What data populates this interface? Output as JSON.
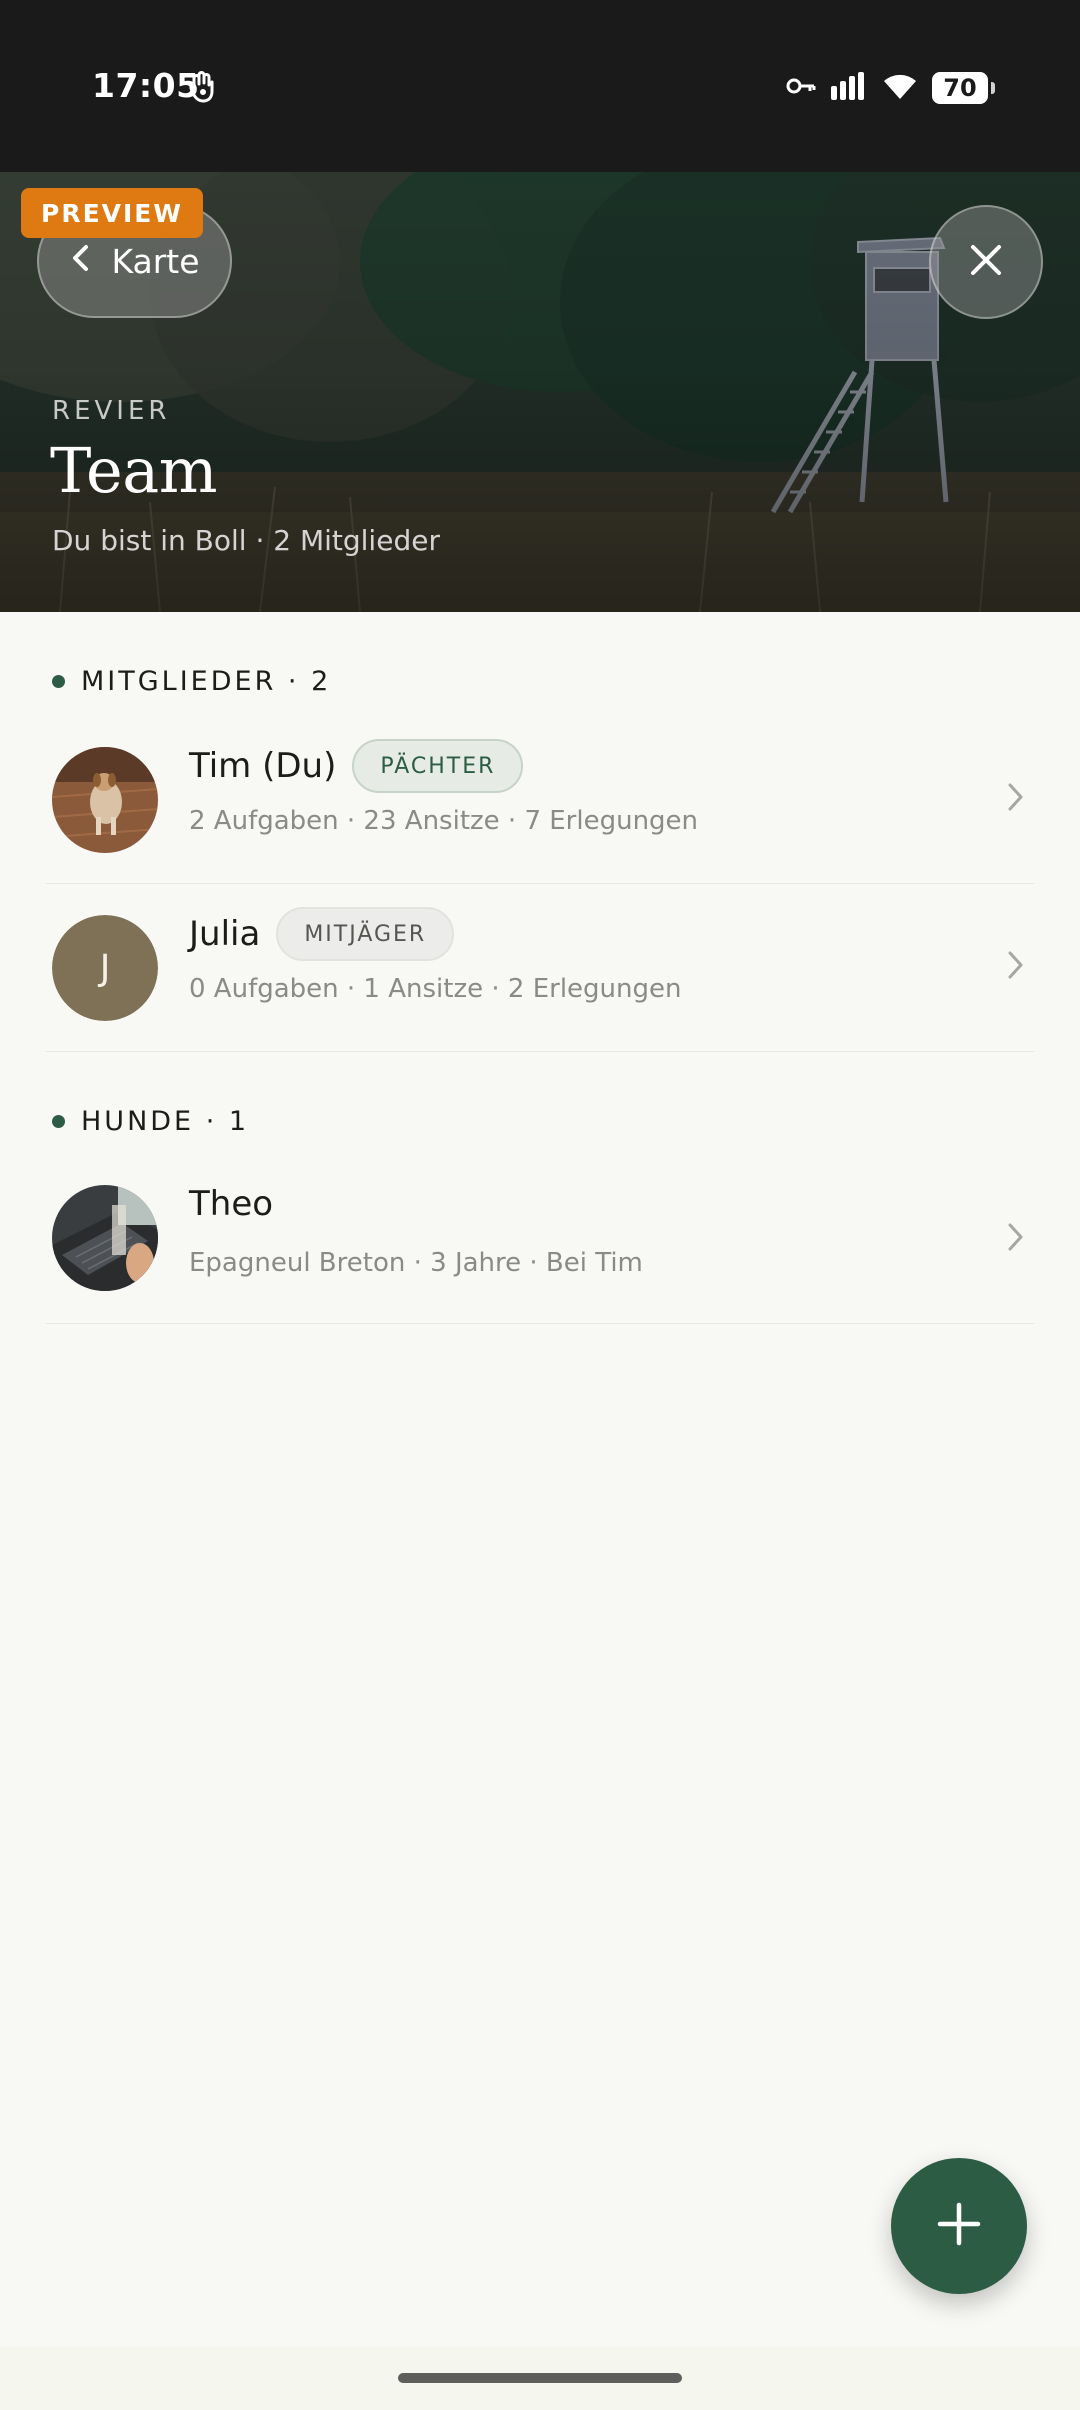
{
  "status_bar": {
    "time": "17:05",
    "battery": "70",
    "icons": [
      "notification-hand-icon",
      "vpn-key-icon",
      "signal-icon",
      "wifi-icon",
      "battery-icon"
    ]
  },
  "hero": {
    "preview_label": "PREVIEW",
    "back_label": "Karte",
    "overline": "REVIER",
    "title": "Team",
    "subtitle": "Du bist in Boll · 2 Mitglieder"
  },
  "sections": {
    "members": {
      "header": "MITGLIEDER · 2",
      "items": [
        {
          "name": "Tim (Du)",
          "badge": "PÄCHTER",
          "meta": "2 Aufgaben · 23 Ansitze · 7 Erlegungen",
          "avatar": "photo"
        },
        {
          "name": "Julia",
          "badge": "MITJÄGER",
          "meta": "0 Aufgaben · 1 Ansitze · 2 Erlegungen",
          "avatar_letter": "J"
        }
      ]
    },
    "dogs": {
      "header": "HUNDE · 1",
      "items": [
        {
          "name": "Theo",
          "meta": "Epagneul Breton · 3 Jahre · Bei Tim",
          "avatar": "photo"
        }
      ]
    }
  },
  "colors": {
    "accent": "#2d5c45",
    "preview_badge": "#df7a13",
    "avatar_julia": "#7e7155",
    "background": "#f8f8f5"
  }
}
